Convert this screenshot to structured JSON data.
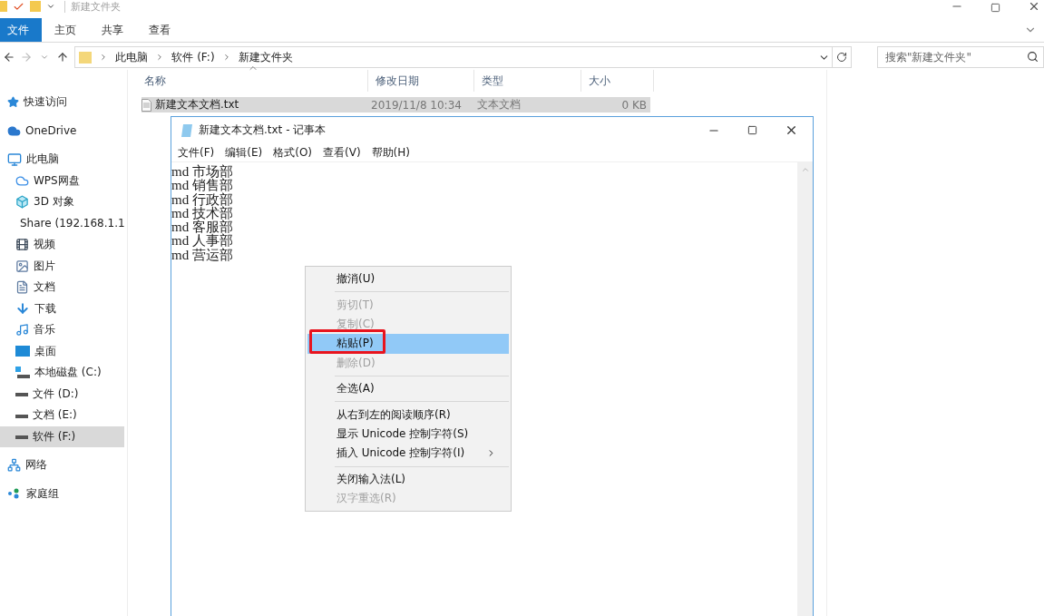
{
  "explorer": {
    "title": "新建文件夹",
    "ribbon_tabs": [
      {
        "label": "文件",
        "selected": true
      },
      {
        "label": "主页",
        "selected": false
      },
      {
        "label": "共享",
        "selected": false
      },
      {
        "label": "查看",
        "selected": false
      }
    ],
    "address": {
      "crumbs": [
        "此电脑",
        "软件 (F:)",
        "新建文件夹"
      ]
    },
    "search": {
      "placeholder": "搜索\"新建文件夹\""
    },
    "sidebar": {
      "items": [
        {
          "label": "快速访问",
          "selected": false
        },
        {
          "label": "OneDrive",
          "selected": false
        },
        {
          "label": "此电脑",
          "selected": false,
          "children": [
            {
              "label": "WPS网盘",
              "selected": false
            },
            {
              "label": "3D 对象",
              "selected": false
            },
            {
              "label": "Share (192.168.1.1",
              "selected": false
            },
            {
              "label": "视频",
              "selected": false
            },
            {
              "label": "图片",
              "selected": false
            },
            {
              "label": "文档",
              "selected": false
            },
            {
              "label": "下载",
              "selected": false
            },
            {
              "label": "音乐",
              "selected": false
            },
            {
              "label": "桌面",
              "selected": false
            },
            {
              "label": "本地磁盘 (C:)",
              "selected": false
            },
            {
              "label": "文件 (D:)",
              "selected": false
            },
            {
              "label": "文档 (E:)",
              "selected": false
            },
            {
              "label": "软件 (F:)",
              "selected": true
            }
          ]
        },
        {
          "label": "网络",
          "selected": false
        },
        {
          "label": "家庭组",
          "selected": false
        }
      ]
    },
    "table": {
      "columns": [
        "名称",
        "修改日期",
        "类型",
        "大小"
      ],
      "rows": [
        {
          "cells": [
            "新建文本文档.txt",
            "2019/11/8 10:34",
            "文本文档",
            "0 KB"
          ],
          "selected": true
        }
      ]
    }
  },
  "notepad": {
    "title": "新建文本文档.txt - 记事本",
    "menu": [
      "文件(F)",
      "编辑(E)",
      "格式(O)",
      "查看(V)",
      "帮助(H)"
    ],
    "lines": [
      "md 市场部",
      "md 销售部",
      "md 行政部",
      "md 技术部",
      "md 客服部",
      "md 人事部",
      "md 营运部"
    ]
  },
  "context_menu": {
    "items": [
      {
        "kind": "item",
        "label": "撤消(U)",
        "disabled": false,
        "selected": false,
        "marked": false,
        "submenu": false
      },
      {
        "kind": "separator"
      },
      {
        "kind": "item",
        "label": "剪切(T)",
        "disabled": true,
        "selected": false,
        "marked": false,
        "submenu": false
      },
      {
        "kind": "item",
        "label": "复制(C)",
        "disabled": true,
        "selected": false,
        "marked": false,
        "submenu": false
      },
      {
        "kind": "item",
        "label": "粘贴(P)",
        "disabled": false,
        "selected": true,
        "marked": true,
        "submenu": false
      },
      {
        "kind": "item",
        "label": "删除(D)",
        "disabled": true,
        "selected": false,
        "marked": false,
        "submenu": false
      },
      {
        "kind": "separator"
      },
      {
        "kind": "item",
        "label": "全选(A)",
        "disabled": false,
        "selected": false,
        "marked": false,
        "submenu": false
      },
      {
        "kind": "separator"
      },
      {
        "kind": "item",
        "label": "从右到左的阅读顺序(R)",
        "disabled": false,
        "selected": false,
        "marked": false,
        "submenu": false
      },
      {
        "kind": "item",
        "label": "显示 Unicode 控制字符(S)",
        "disabled": false,
        "selected": false,
        "marked": false,
        "submenu": false
      },
      {
        "kind": "item",
        "label": "插入 Unicode 控制字符(I)",
        "disabled": false,
        "selected": false,
        "marked": false,
        "submenu": true
      },
      {
        "kind": "separator"
      },
      {
        "kind": "item",
        "label": "关闭输入法(L)",
        "disabled": false,
        "selected": false,
        "marked": false,
        "submenu": false
      },
      {
        "kind": "item",
        "label": "汉字重选(R)",
        "disabled": true,
        "selected": false,
        "marked": false,
        "submenu": false
      }
    ]
  }
}
